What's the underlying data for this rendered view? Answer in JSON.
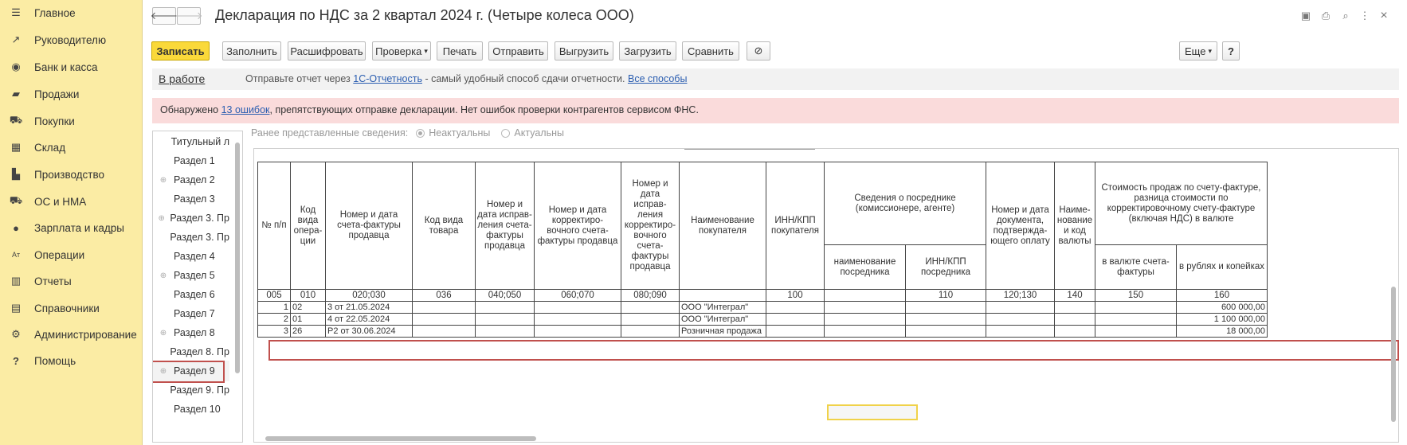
{
  "sidebar": {
    "items": [
      {
        "label": "Главное",
        "icon": "menu-icon",
        "glyph": "☰"
      },
      {
        "label": "Руководителю",
        "icon": "trend-chart-icon",
        "glyph": "↗"
      },
      {
        "label": "Банк и касса",
        "icon": "coins-icon",
        "glyph": "◉"
      },
      {
        "label": "Продажи",
        "icon": "shopping-bag-icon",
        "glyph": "▰"
      },
      {
        "label": "Покупки",
        "icon": "cart-icon",
        "glyph": "⛟"
      },
      {
        "label": "Склад",
        "icon": "warehouse-icon",
        "glyph": "▦"
      },
      {
        "label": "Производство",
        "icon": "factory-icon",
        "glyph": "▙"
      },
      {
        "label": "ОС и НМА",
        "icon": "truck-icon",
        "glyph": "⛟"
      },
      {
        "label": "Зарплата и кадры",
        "icon": "person-icon",
        "glyph": "●"
      },
      {
        "label": "Операции",
        "icon": "operations-icon",
        "glyph": "Aт"
      },
      {
        "label": "Отчеты",
        "icon": "bar-chart-icon",
        "glyph": "▥"
      },
      {
        "label": "Справочники",
        "icon": "books-icon",
        "glyph": "▤"
      },
      {
        "label": "Администрирование",
        "icon": "gear-icon",
        "glyph": "⚙"
      },
      {
        "label": "Помощь",
        "icon": "question-icon",
        "glyph": "?"
      }
    ]
  },
  "header": {
    "back_glyph": "🡐",
    "forward_glyph": "🡒",
    "title": "Декларация по НДС за 2 квартал 2024 г. (Четыре колеса ООО)",
    "icons": {
      "save": "▣",
      "print": "⎙",
      "preview": "⌕",
      "more": "⋮",
      "close": "×"
    }
  },
  "toolbar": {
    "write": "Записать",
    "fill": "Заполнить",
    "decode": "Расшифровать",
    "check": "Проверка",
    "print": "Печать",
    "send": "Отправить",
    "export": "Выгрузить",
    "import": "Загрузить",
    "compare": "Сравнить",
    "attach_glyph": "⊘",
    "more": "Еще",
    "help": "?",
    "dropdown_glyph": "▾"
  },
  "status": {
    "state_link": "В работе",
    "msg_prefix": "Отправьте отчет через ",
    "msg_link": "1С-Отчетность",
    "msg_middle": " - самый удобный способ сдачи отчетности. ",
    "msg_link2": "Все способы"
  },
  "errors": {
    "prefix": "Обнаружено ",
    "link": "13 ошибок",
    "suffix": ", препятствующих отправке декларации. Нет ошибок проверки контрагентов сервисом ФНС."
  },
  "sections": {
    "items": [
      {
        "label": "Титульный л",
        "expandable": false
      },
      {
        "label": "Раздел 1",
        "expandable": false
      },
      {
        "label": "Раздел 2",
        "expandable": true
      },
      {
        "label": "Раздел 3",
        "expandable": false
      },
      {
        "label": "Раздел 3. Пр",
        "expandable": true
      },
      {
        "label": "Раздел 3. Пр",
        "expandable": false
      },
      {
        "label": "Раздел 4",
        "expandable": false
      },
      {
        "label": "Раздел 5",
        "expandable": true
      },
      {
        "label": "Раздел 6",
        "expandable": false
      },
      {
        "label": "Раздел 7",
        "expandable": false
      },
      {
        "label": "Раздел 8",
        "expandable": true
      },
      {
        "label": "Раздел 8. Пр",
        "expandable": false
      },
      {
        "label": "Раздел 9",
        "expandable": true
      },
      {
        "label": "Раздел 9. Пр",
        "expandable": false
      },
      {
        "label": "Раздел 10",
        "expandable": false
      }
    ],
    "selected": "Раздел 9",
    "expand_glyph": "⊕"
  },
  "filters": {
    "label": "Ранее представленные сведения:",
    "option1": "Неактуальны",
    "option2": "Актуальны",
    "selected": "Неактуальны"
  },
  "table": {
    "headers": {
      "num": "№ п/п",
      "op_code": "Код вида опера-ции",
      "invoice": "Номер и дата счета-фактуры продавца",
      "goods_code": "Код вида товара",
      "corr_invoice": "Номер и дата исправ-ления счета-фактуры продавца",
      "adj_invoice": "Номер и дата корректиро-вочного счета-фактуры продавца",
      "corr_adj_invoice": "Номер и дата исправ-ления корректиро-вочного счета-фактуры продавца",
      "buyer": "Наименование покупателя",
      "buyer_inn": "ИНН/КПП покупателя",
      "intermediary": "Сведения о посреднике (комиссионере, агенте)",
      "inter_name": "наименование посредника",
      "inter_inn": "ИНН/КПП посредника",
      "payment_doc": "Номер и дата документа, подтвержда-ющего оплату",
      "currency": "Наиме-нование и код валюты",
      "sales_value": "Стоимость продаж по счету-фактуре, разница стоимости по корректировочному счету-фактуре (включая НДС) в валюте",
      "in_currency": "в валюте счета-фактуры",
      "in_rubles": "в рублях и копейках"
    },
    "column_codes": [
      "005",
      "010",
      "020;030",
      "036",
      "040;050",
      "060;070",
      "080;090",
      "",
      "100",
      "",
      "110",
      "120;130",
      "140",
      "150",
      "160"
    ],
    "rows": [
      {
        "n": "1",
        "op": "02",
        "invoice": "3 от 21.05.2024",
        "buyer": "ООО \"Интеграл\"",
        "rub": "600 000,00"
      },
      {
        "n": "2",
        "op": "01",
        "invoice": "4 от 22.05.2024",
        "buyer": "ООО \"Интеграл\"",
        "rub": "1 100 000,00"
      },
      {
        "n": "3",
        "op": "26",
        "invoice": "Р2 от 30.06.2024",
        "buyer": "Розничная продажа",
        "rub": "18 000,00"
      }
    ]
  }
}
